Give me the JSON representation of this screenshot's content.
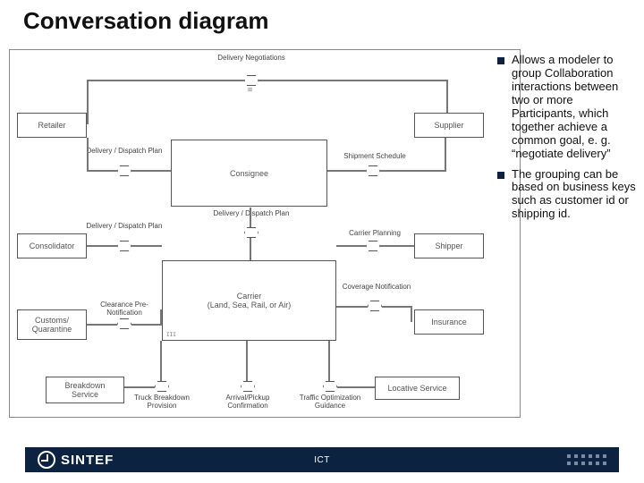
{
  "title": "Conversation diagram",
  "bullets": [
    "Allows a modeler to group Collaboration interactions between two or more Participants, which together achieve a common goal, e. g. “negotiate delivery”",
    "The grouping can be based on business keys such as customer id or shipping id."
  ],
  "participants": {
    "retailer": "Retailer",
    "supplier": "Supplier",
    "consignee": "Consignee",
    "consolidator": "Consolidator",
    "shipper": "Shipper",
    "customs": "Customs/\nQuarantine",
    "insurance": "Insurance",
    "carrier": "Carrier\n(Land, Sea, Rail, or Air)",
    "breakdown": "Breakdown\nService",
    "locative": "Locative Service"
  },
  "conversations": {
    "delivery_neg": "Delivery\nNegotiations",
    "dd_plan_1": "Delivery / Dispatch\nPlan",
    "ship_sched": "Shipment Schedule",
    "dd_plan_2": "Delivery / Dispatch\nPlan",
    "dd_plan_center": "Delivery / Dispatch\nPlan",
    "carrier_plan": "Carrier Planning",
    "clearance": "Clearance Pre-\nNotification",
    "coverage": "Coverage\nNotification",
    "truck_breakdown": "Truck Breakdown\nProvision",
    "arrival": "Arrival/Pickup\nConfirmation",
    "traffic": "Traffic Optimization\nGuidance"
  },
  "footer": {
    "brand": "SINTEF",
    "ict": "ICT"
  }
}
